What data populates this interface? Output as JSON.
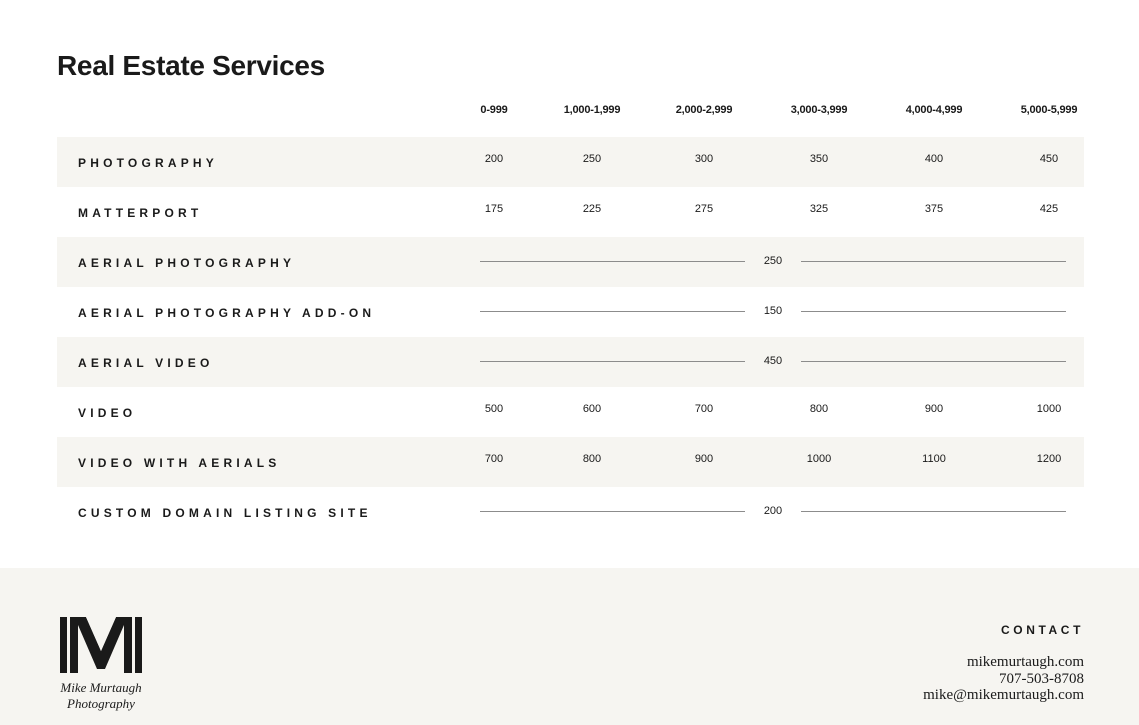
{
  "title": "Real Estate Services",
  "columns": [
    "0-999",
    "1,000-1,999",
    "2,000-2,999",
    "3,000-3,999",
    "4,000-4,999",
    "5,000-5,999"
  ],
  "rows": [
    {
      "label": "Photography",
      "values": [
        "200",
        "250",
        "300",
        "350",
        "400",
        "450"
      ]
    },
    {
      "label": "Matterport",
      "values": [
        "175",
        "225",
        "275",
        "325",
        "375",
        "425"
      ]
    },
    {
      "label": "Aerial Photography",
      "flat": "250"
    },
    {
      "label": "Aerial Photography Add-On",
      "flat": "150"
    },
    {
      "label": "Aerial Video",
      "flat": "450"
    },
    {
      "label": "Video",
      "values": [
        "500",
        "600",
        "700",
        "800",
        "900",
        "1000"
      ]
    },
    {
      "label": "Video with Aerials",
      "values": [
        "700",
        "800",
        "900",
        "1000",
        "1100",
        "1200"
      ]
    },
    {
      "label": "Custom Domain Listing Site",
      "flat": "200"
    }
  ],
  "footer": {
    "logo_text": "Mike Murtaugh Photography",
    "contact_heading": "CONTACT",
    "website": "mikemurtaugh.com",
    "phone": "707-503-8708",
    "email": "mike@mikemurtaugh.com"
  }
}
